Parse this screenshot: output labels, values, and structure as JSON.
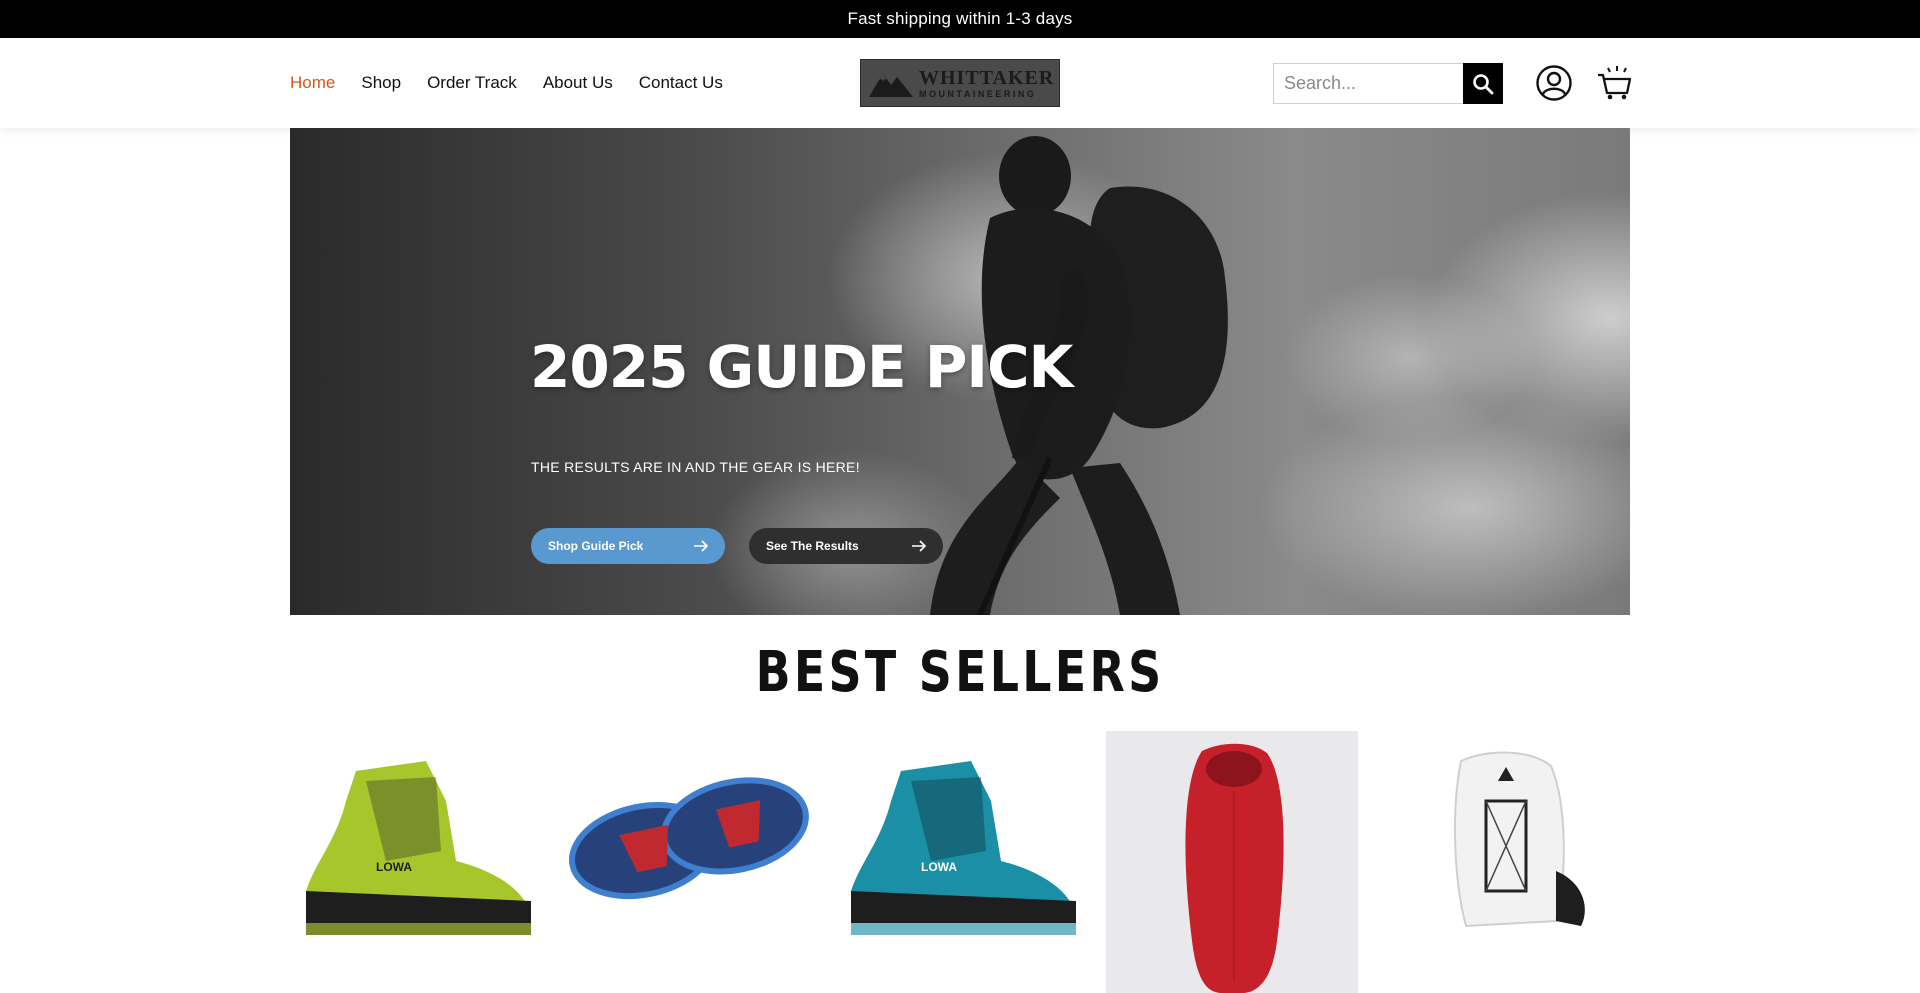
{
  "announcement": "Fast shipping within 1-3 days",
  "nav": {
    "items": [
      {
        "label": "Home",
        "active": true
      },
      {
        "label": "Shop"
      },
      {
        "label": "Order Track"
      },
      {
        "label": "About Us"
      },
      {
        "label": "Contact Us"
      }
    ]
  },
  "logo": {
    "line1": "WHITTAKER",
    "line2": "MOUNTAINEERING"
  },
  "search": {
    "placeholder": "Search..."
  },
  "icons": {
    "search": "search-icon",
    "account": "user-circle-icon",
    "cart": "shopping-cart-icon",
    "arrow": "arrow-right-icon"
  },
  "hero": {
    "title": "2025 GUIDE PICK",
    "subtitle": "THE RESULTS ARE IN AND THE GEAR IS HERE!",
    "primary_button": "Shop Guide Pick",
    "secondary_button": "See The Results"
  },
  "best_sellers": {
    "title": "BEST SELLERS",
    "products": [
      {
        "image": "lime-green-mountaineering-boot"
      },
      {
        "image": "blue-snowshoes"
      },
      {
        "image": "teal-mountaineering-boot"
      },
      {
        "image": "red-sleeping-bag"
      },
      {
        "image": "white-backpack"
      }
    ]
  },
  "colors": {
    "accent": "#d2581e",
    "primary_button": "#5a98d0",
    "secondary_button": "#2f2f2f",
    "announcement_bg": "#000000"
  }
}
